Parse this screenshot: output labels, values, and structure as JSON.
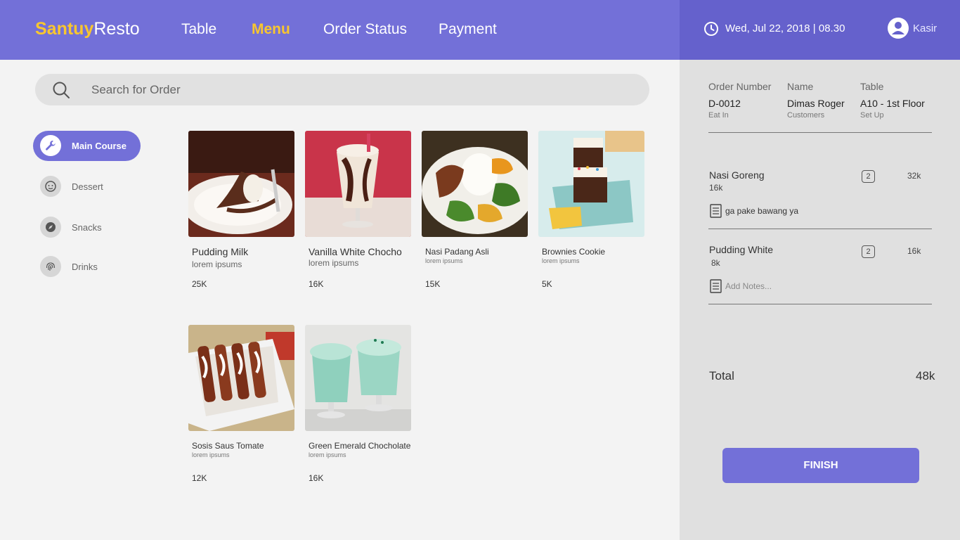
{
  "header": {
    "brand_bold": "Santuy",
    "brand_light": "Resto",
    "nav": [
      "Table",
      "Menu",
      "Order Status",
      "Payment"
    ],
    "active_nav": "Menu",
    "datetime": "Wed, Jul 22, 2018 | 08.30",
    "user": "Kasir"
  },
  "search": {
    "placeholder": "Search for Order"
  },
  "categories": [
    {
      "label": "Main Course",
      "icon": "wrench-icon",
      "active": true
    },
    {
      "label": "Dessert",
      "icon": "face-icon",
      "active": false
    },
    {
      "label": "Snacks",
      "icon": "compass-icon",
      "active": false
    },
    {
      "label": "Drinks",
      "icon": "fingerprint-icon",
      "active": false
    }
  ],
  "menu": [
    {
      "name": "Pudding Milk",
      "desc": "lorem ipsums",
      "price": "25K"
    },
    {
      "name": "Vanilla White Chocho",
      "desc": "lorem ipsums",
      "price": "16K"
    },
    {
      "name": "Nasi Padang Asli",
      "desc": "lorem ipsums",
      "price": "15K"
    },
    {
      "name": "Brownies Cookie",
      "desc": "lorem ipsums",
      "price": "5K"
    },
    {
      "name": "Sosis Saus Tomate",
      "desc": "lorem ipsums",
      "price": "12K"
    },
    {
      "name": "Green Emerald Chocholate",
      "desc": "lorem ipsums",
      "price": "16K"
    }
  ],
  "order": {
    "number_label": "Order Number",
    "number": "D-0012",
    "number_sub": "Eat In",
    "name_label": "Name",
    "name": "Dimas Roger",
    "name_sub": "Customers",
    "table_label": "Table",
    "table": "A10 - 1st Floor",
    "table_sub": "Set Up",
    "items": [
      {
        "name": "Nasi Goreng",
        "price": "16k",
        "qty": "2",
        "total": "32k",
        "note": "ga pake bawang ya"
      },
      {
        "name": "Pudding White",
        "price": "8k",
        "qty": "2",
        "total": "16k",
        "note_placeholder": "Add Notes..."
      }
    ],
    "total_label": "Total",
    "total": "48k",
    "finish_label": "FINISH"
  },
  "colors": {
    "primary": "#7370d8",
    "accent": "#f8c62f",
    "panel": "#e0e0e0"
  }
}
